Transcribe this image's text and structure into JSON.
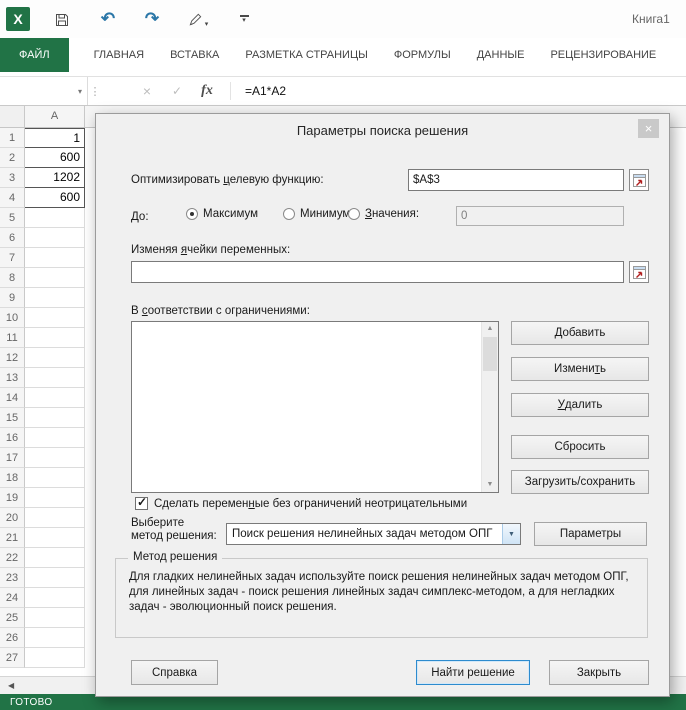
{
  "colors": {
    "excel_green": "#217346",
    "default_button_border": "#2d8bce"
  },
  "icons": {
    "logo_letter": "X",
    "undo": "↶",
    "redo": "↷",
    "customize": "▾",
    "name_box_arrow": "▾",
    "separator_dots": "⋮",
    "cancel": "×",
    "enter": "✓",
    "fx": "fx",
    "combo_arrow": "▼",
    "scroll_up": "▲",
    "scroll_down": "▼",
    "sheet_nav": "◀",
    "close": "×",
    "checkmark": "✓"
  },
  "titlebar": {
    "workbook_title": "Книга1"
  },
  "ribbon": {
    "tabs": [
      {
        "name": "file",
        "label": "ФАЙЛ",
        "active": true
      },
      {
        "name": "home",
        "label": "ГЛАВНАЯ"
      },
      {
        "name": "insert",
        "label": "ВСТАВКА"
      },
      {
        "name": "page-layout",
        "label": "РАЗМЕТКА СТРАНИЦЫ"
      },
      {
        "name": "formulas",
        "label": "ФОРМУЛЫ"
      },
      {
        "name": "data",
        "label": "ДАННЫЕ"
      },
      {
        "name": "review",
        "label": "РЕЦЕНЗИРОВАНИЕ"
      }
    ]
  },
  "formula_bar": {
    "name_box_value": "",
    "formula": "=A1*A2"
  },
  "grid": {
    "column_header": "A",
    "rows": [
      {
        "n": "1",
        "v": "1",
        "bordered": true
      },
      {
        "n": "2",
        "v": "600",
        "bordered": true
      },
      {
        "n": "3",
        "v": "1202",
        "bordered": true
      },
      {
        "n": "4",
        "v": "600",
        "bordered": true
      },
      {
        "n": "5",
        "v": ""
      },
      {
        "n": "6",
        "v": ""
      },
      {
        "n": "7",
        "v": ""
      },
      {
        "n": "8",
        "v": ""
      },
      {
        "n": "9",
        "v": ""
      },
      {
        "n": "10",
        "v": ""
      },
      {
        "n": "11",
        "v": ""
      },
      {
        "n": "12",
        "v": ""
      },
      {
        "n": "13",
        "v": ""
      },
      {
        "n": "14",
        "v": ""
      },
      {
        "n": "15",
        "v": ""
      },
      {
        "n": "16",
        "v": ""
      },
      {
        "n": "17",
        "v": ""
      },
      {
        "n": "18",
        "v": ""
      },
      {
        "n": "19",
        "v": ""
      },
      {
        "n": "20",
        "v": ""
      },
      {
        "n": "21",
        "v": ""
      },
      {
        "n": "22",
        "v": ""
      },
      {
        "n": "23",
        "v": ""
      },
      {
        "n": "24",
        "v": ""
      },
      {
        "n": "25",
        "v": ""
      },
      {
        "n": "26",
        "v": ""
      },
      {
        "n": "27",
        "v": ""
      }
    ]
  },
  "status_bar": {
    "label": "ГОТОВО"
  },
  "dialog": {
    "title": "Параметры поиска решения",
    "objective": {
      "label": {
        "pre": "Оптимизировать ",
        "key": "ц",
        "post": "елевую функцию:"
      },
      "value": "$A$3"
    },
    "direction": {
      "label": "До:",
      "max_label": "Максимум",
      "min_label": "Минимум",
      "value_label": {
        "pre": "",
        "key": "З",
        "post": "начения:"
      },
      "value_input": "0",
      "selected_option": "Максимум"
    },
    "variables": {
      "label": {
        "pre": "Изменяя ",
        "key": "я",
        "post": "чейки переменных:"
      },
      "value": ""
    },
    "constraints": {
      "label": {
        "pre": "В ",
        "key": "с",
        "post": "оответствии с ограничениями:"
      },
      "items": [],
      "buttons": [
        {
          "name": "add-button",
          "pre": "",
          "key": "Д",
          "post": "обавить"
        },
        {
          "name": "change-button",
          "pre": "Измени",
          "key": "т",
          "post": "ь"
        },
        {
          "name": "delete-button",
          "pre": "",
          "key": "У",
          "post": "далить"
        },
        {
          "name": "reset-button",
          "pre": "Сбросить",
          "key": "",
          "post": ""
        },
        {
          "name": "load-save-button",
          "pre": "Загрузить/сохранить",
          "key": "",
          "post": ""
        }
      ]
    },
    "nonnegative": {
      "checked": true,
      "label": {
        "pre": "Сделать перемен",
        "key": "н",
        "post": "ые без ограничений неотрицательными"
      }
    },
    "method": {
      "label_line1": "Выберите",
      "label_line2": "метод решения:",
      "dropdown_value": "Поиск решения нелинейных задач методом ОПГ",
      "options_button": "Параметры"
    },
    "method_group": {
      "title": "Метод решения",
      "description": "Для гладких нелинейных задач используйте поиск решения нелинейных задач методом ОПГ, для линейных задач - поиск решения линейных задач симплекс-методом, а для негладких задач - эволюционный поиск решения."
    },
    "footer": {
      "help_button": "Справка",
      "solve_button": "Найти решение",
      "close_button": "Закрыть"
    }
  }
}
